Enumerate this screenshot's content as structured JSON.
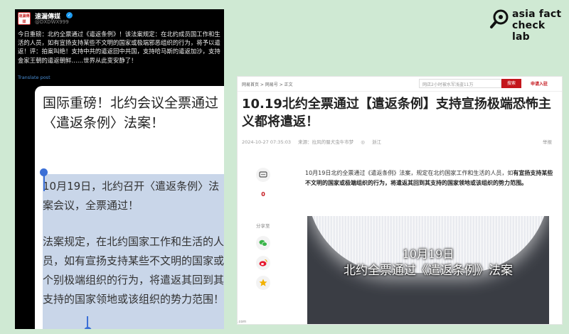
{
  "brand": {
    "line1": "asia fact",
    "line2": "check lab"
  },
  "tweet": {
    "avatar_text": "速漏傳媒",
    "name": "速漏傳媒",
    "handle": "@DXDWX999",
    "body": "今日重磅：北约全票通过《遣返条例》！该法案规定：在北约成员国工作和生活的人员，如有宣扬支持某些不文明的国家或极端邪恶组织的行为，将予以遣返！评：拍案叫绝！支持中共的遣返回中共国，支持哈马斯的遣返加沙，支持金家王朝的遣返朝鲜……世界从此变安静了！",
    "translate": "Translate post",
    "card": {
      "title": "国际重磅！北约会议全票通过〈遣返条例〉法案！",
      "p1": "10月19日，北约召开〈遣返条例〉法案会议，全票通过！",
      "p2": "法案规定，在北约国家工作和生活的人员，如有宣扬支持某些不文明的国家或个别极端组织的行为，将遣返其回到其支持的国家领地或该组织的势力范围！"
    }
  },
  "article": {
    "breadcrumb": "网易首页 > 网易号 > 正文",
    "search_placeholder": "网店2小时被水军浅盗11万",
    "search_button": "搜索",
    "apply": "申请入驻",
    "title": "10.19北约全票通过【遣返条例】支持宣扬极端恐怖主义都将遣返！",
    "meta": {
      "datetime": "2024-10-27 07:35:03",
      "source": "来源：拉风的蜀犬虫牛市梦",
      "location": "浙江"
    },
    "report": "举报",
    "share_label": "分享至",
    "lead_plain": "10月19日北约全票通过《遣返条例》法案，规定在北约国家工作和生活的人员，如",
    "lead_bold": "有宣扬支持某些不文明的国家或极端组织的行为，将遣返其回到其支持的国家领地或该组织的势力范围。",
    "video": {
      "date": "10月19日",
      "caption": "北约全票通过《遣返条例》法案"
    },
    "footer_url": ".com"
  },
  "icons": {
    "brand": "magnifier-check-icon",
    "verified": "verified-badge-icon",
    "comment": "comment-icon",
    "count": "count-icon",
    "wechat": "wechat-icon",
    "weibo": "weibo-icon",
    "favorite": "star-icon"
  },
  "colors": {
    "background": "#cfe9d3",
    "accent_red": "#c4161c",
    "selection": "#c9d6e9",
    "handle_blue": "#3b6fd6"
  }
}
